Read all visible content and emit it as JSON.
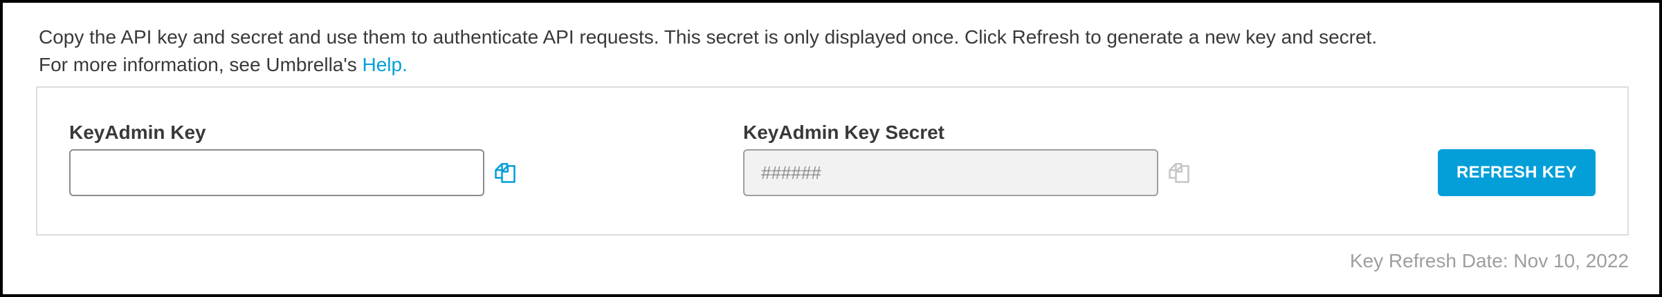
{
  "intro": {
    "line1": "Copy the API key and secret and use them to authenticate API requests. This secret is only displayed once. Click Refresh to generate a new key and secret.",
    "line2_prefix": "For more information, see Umbrella's ",
    "help_link": "Help."
  },
  "key_field": {
    "label": "KeyAdmin Key",
    "value": "",
    "copy_icon": "copy-icon"
  },
  "secret_field": {
    "label": "KeyAdmin Key Secret",
    "placeholder": "######",
    "copy_icon": "copy-icon"
  },
  "refresh_button": {
    "label": "REFRESH KEY"
  },
  "refresh_date": {
    "text": "Key Refresh Date: Nov 10, 2022"
  },
  "colors": {
    "accent": "#049fd9",
    "text": "#39393b",
    "muted": "#9e9ea2",
    "border": "#dcdcdf",
    "readonly_bg": "#f2f2f2"
  }
}
